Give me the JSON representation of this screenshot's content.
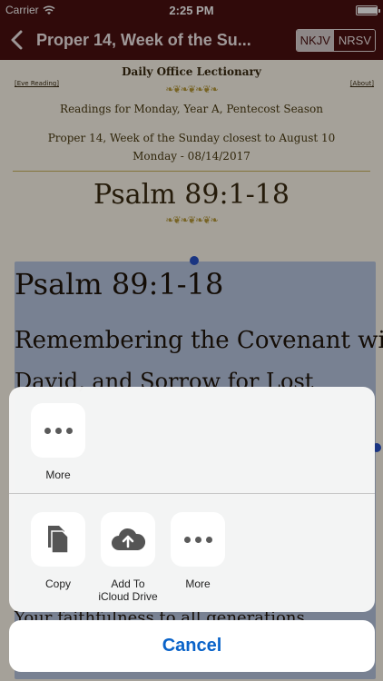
{
  "status": {
    "carrier": "Carrier",
    "time": "2:25 PM"
  },
  "nav": {
    "back_icon": "chevron-left-icon",
    "title": "Proper 14, Week of the Su...",
    "versions": [
      "NKJV",
      "NRSV"
    ]
  },
  "lectionary": {
    "title": "Daily Office Lectionary",
    "left_link": "[Eve Reading]",
    "right_link": "[About]",
    "readings_line": "Readings for Monday, Year A, Pentecost Season",
    "proper_line": "Proper 14, Week of the Sunday closest to August 10",
    "date_line": "Monday - 08/14/2017",
    "psalm_title": "Psalm 89:1-18"
  },
  "selected_text": {
    "heading": "Psalm 89:1-18",
    "line2": "Remembering the Covenant with",
    "line3": "David, and Sorrow for Lost",
    "bottom_line": "Your faithfulness to all generations"
  },
  "share_sheet": {
    "top_actions": [
      {
        "label": "More",
        "icon": "more-icon"
      }
    ],
    "bottom_actions": [
      {
        "label": "Copy",
        "icon": "copy-icon"
      },
      {
        "label": "Add To\niCloud Drive",
        "icon": "icloud-upload-icon"
      },
      {
        "label": "More",
        "icon": "more-icon"
      }
    ],
    "cancel_label": "Cancel"
  },
  "colors": {
    "nav_bg": "#4a1010",
    "page_bg": "#fdf8ec",
    "selection": "#b9c7e0",
    "ios_blue": "#0a63c9"
  }
}
